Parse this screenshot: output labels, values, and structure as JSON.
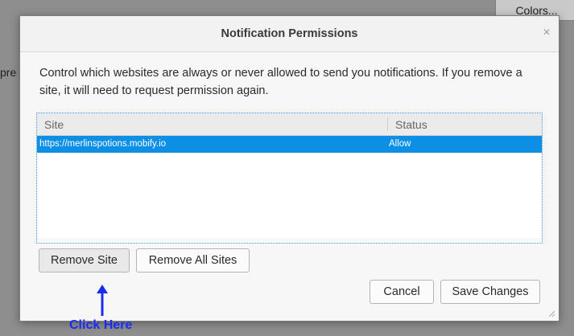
{
  "background": {
    "colors_button_label": "Colors...",
    "left_text_fragment": "pre"
  },
  "dialog": {
    "title": "Notification Permissions",
    "close_glyph": "×",
    "description": "Control which websites are always or never allowed to send you notifications. If you remove a site, it will need to request permission again.",
    "columns": {
      "site": "Site",
      "status": "Status"
    },
    "rows": [
      {
        "site": "https://merlinspotions.mobify.io",
        "status": "Allow"
      }
    ],
    "buttons": {
      "remove_site": "Remove Site",
      "remove_all_sites": "Remove All Sites",
      "cancel": "Cancel",
      "save_changes": "Save Changes"
    }
  },
  "annotation": {
    "text": "Click Here",
    "color": "#1a2cf0"
  },
  "colors": {
    "selection": "#0d8fe6",
    "focus_border": "#3a8fd8"
  }
}
